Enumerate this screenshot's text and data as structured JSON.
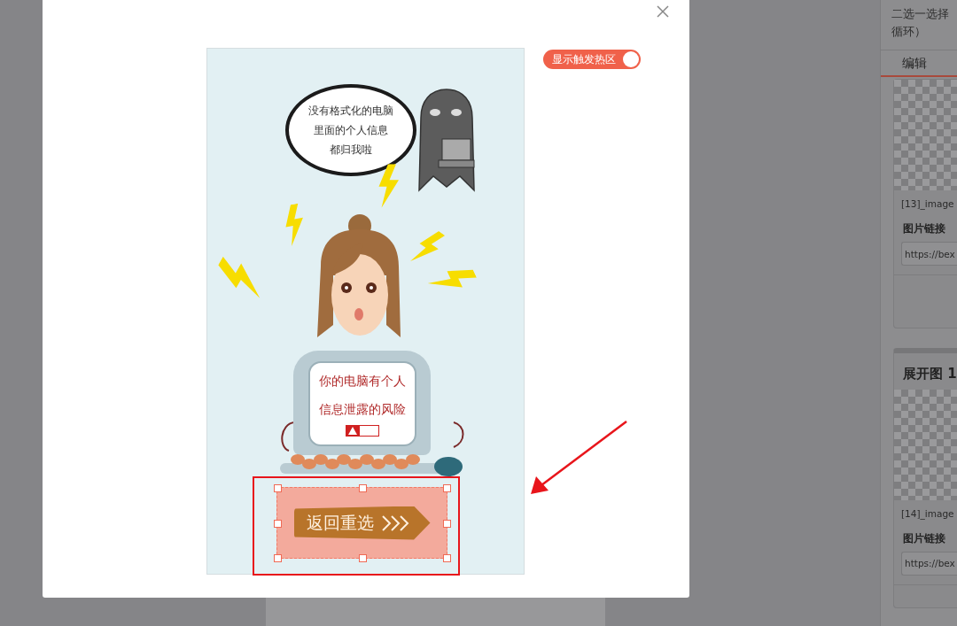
{
  "background_panel": {
    "header_lines": [
      "二选一选择",
      "循环）"
    ],
    "tab": {
      "label": "编辑",
      "selected": true
    },
    "cards": [
      {
        "caption": "[13]_image",
        "link_label": "图片链接",
        "link_value": "https://bex"
      },
      {
        "title": "展开图 1",
        "caption": "[14]_image",
        "link_label": "图片链接",
        "link_value": "https://bex"
      }
    ]
  },
  "modal": {
    "toggle": {
      "label": "显示触发热区",
      "on": true
    },
    "preview": {
      "bubble_lines": [
        "没有格式化的电脑",
        "里面的个人信息",
        "都归我啦"
      ],
      "screen_lines": [
        "你的电脑有个人",
        "信息泄露的风险"
      ],
      "hotspot": {
        "button_label": "返回重选",
        "selected": true
      }
    }
  }
}
